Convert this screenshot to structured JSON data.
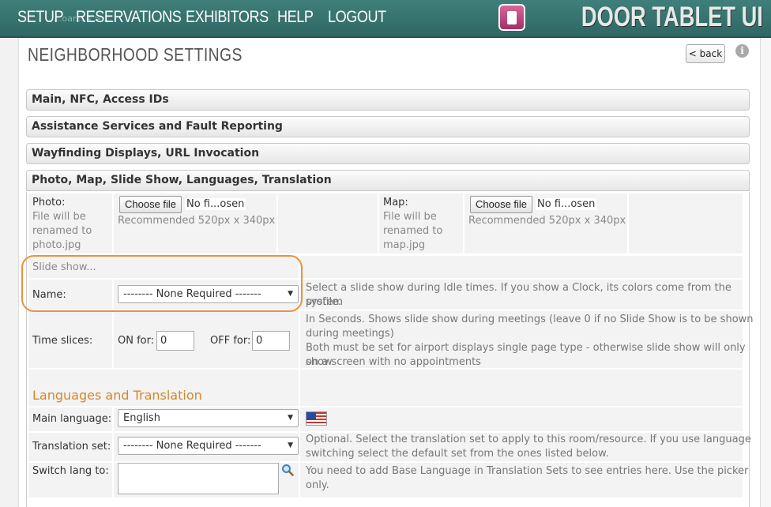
{
  "nav": {
    "items": [
      "SETUP",
      "RESERVATIONS",
      "EXHIBITORS",
      "HELP",
      "LOGOUT"
    ],
    "ghost_text": "...oar... s > ..."
  },
  "brand": {
    "name": "DOOR TABLET UI"
  },
  "page": {
    "title": "NEIGHBORHOOD SETTINGS",
    "back_label": "< back",
    "info_glyph": "i"
  },
  "accordion": [
    "Main, NFC, Access IDs",
    "Assistance Services and Fault Reporting",
    "Wayfinding Displays, URL Invocation",
    "Photo, Map, Slide Show, Languages, Translation"
  ],
  "photo": {
    "label": "Photo:",
    "rename_note": [
      "File will be",
      "renamed to",
      "photo.jpg"
    ],
    "button": "Choose file",
    "status": "No fi...osen",
    "recommended": "Recommended 520px x 340px"
  },
  "map": {
    "label": "Map:",
    "rename_note": [
      "File will be",
      "renamed to",
      "map.jpg"
    ],
    "button": "Choose file",
    "status": "No fi...osen",
    "recommended": "Recommended 520px x 340px"
  },
  "slideshow": {
    "header": "Slide show...",
    "name_label": "Name:",
    "name_value": "-------- None Required -------",
    "name_help": [
      "Select a slide show during Idle times. If you show a Clock, its colors come from the system",
      "profile."
    ],
    "time_label": "Time slices:",
    "on_label": "ON for:",
    "on_value": "0",
    "off_label": "OFF for:",
    "off_value": "0",
    "time_help": [
      "In Seconds. Shows slide show during meetings (leave 0 if no Slide Show is to be shown",
      "during meetings)",
      "Both must be set for airport displays single page type - otherwise slide show will only show",
      "on a screen with no appointments"
    ]
  },
  "languages": {
    "section_title": "Languages and Translation",
    "main_label": "Main language:",
    "main_value": "English",
    "translation_label": "Translation set:",
    "translation_value": "-------- None Required -------",
    "translation_help": [
      "Optional. Select the translation set to apply to this room/resource. If you use language",
      "switching select the default set from the ones listed below."
    ],
    "switch_label": "Switch lang to:",
    "switch_help": [
      "You need to add Base Language in Translation Sets to see entries here.  Use the picker",
      "only."
    ]
  },
  "colors": {
    "nav_bg": "#3f7f7a",
    "highlight": "#e9933c",
    "section_title": "#d4872c",
    "brand_logo": "#c04a82"
  },
  "icons": {
    "info": "info-icon",
    "search": "search-icon",
    "flag": "us-flag-icon",
    "dropdown": "chevron-down-icon"
  }
}
